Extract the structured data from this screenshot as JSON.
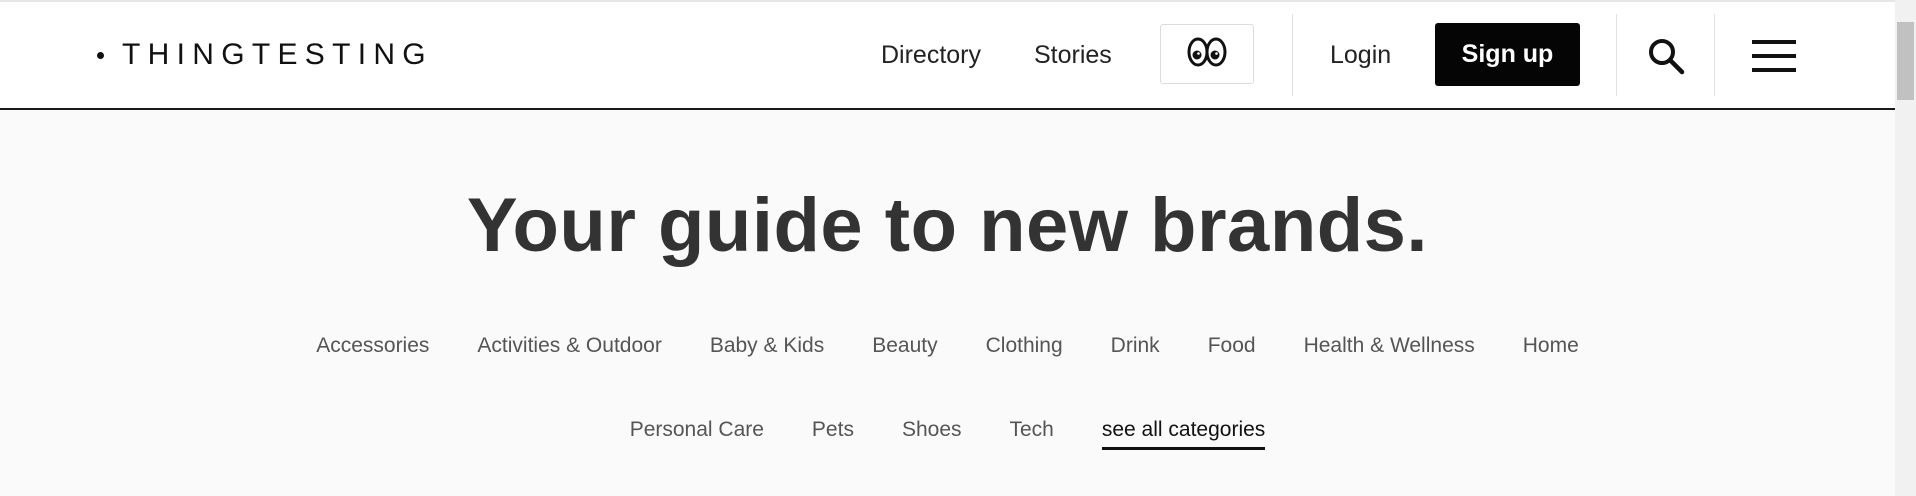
{
  "header": {
    "logo_text": "THINGTESTING",
    "nav": {
      "directory": "Directory",
      "stories": "Stories"
    },
    "login_label": "Login",
    "signup_label": "Sign up",
    "icons": {
      "eyes": "eyes-icon",
      "search": "search-icon",
      "menu": "hamburger-menu-icon"
    }
  },
  "hero": {
    "title": "Your guide to new brands."
  },
  "categories": {
    "row1": [
      "Accessories",
      "Activities & Outdoor",
      "Baby & Kids",
      "Beauty",
      "Clothing",
      "Drink",
      "Food",
      "Health & Wellness",
      "Home"
    ],
    "row2": [
      "Personal Care",
      "Pets",
      "Shoes",
      "Tech"
    ],
    "see_all": "see all categories"
  },
  "colors": {
    "signup_bg": "#050505",
    "title_text": "#333333",
    "category_text": "#555555",
    "header_border": "#1a1a1a"
  }
}
